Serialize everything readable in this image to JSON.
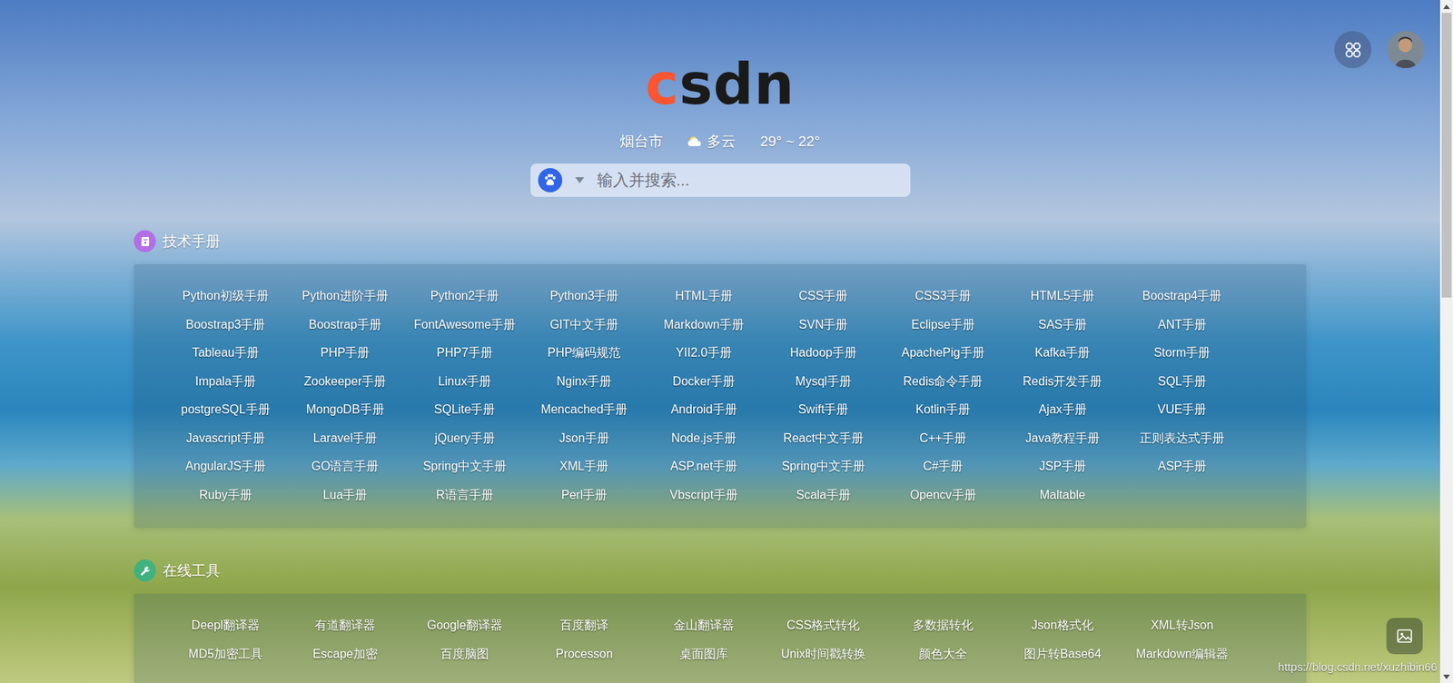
{
  "header": {
    "logo": "csdn",
    "city": "烟台市",
    "weather": "多云",
    "temperature": "29° ~ 22°"
  },
  "search": {
    "placeholder": "输入并搜索..."
  },
  "sections": [
    {
      "title": "技术手册",
      "color": "#b36ee6",
      "items": [
        "Python初级手册",
        "Python进阶手册",
        "Python2手册",
        "Python3手册",
        "HTML手册",
        "CSS手册",
        "CSS3手册",
        "HTML5手册",
        "Boostrap4手册",
        "Boostrap3手册",
        "Boostrap手册",
        "FontAwesome手册",
        "GIT中文手册",
        "Markdown手册",
        "SVN手册",
        "Eclipse手册",
        "SAS手册",
        "ANT手册",
        "Tableau手册",
        "PHP手册",
        "PHP7手册",
        "PHP编码规范",
        "YII2.0手册",
        "Hadoop手册",
        "ApachePig手册",
        "Kafka手册",
        "Storm手册",
        "Impala手册",
        "Zookeeper手册",
        "Linux手册",
        "Nginx手册",
        "Docker手册",
        "Mysql手册",
        "Redis命令手册",
        "Redis开发手册",
        "SQL手册",
        "postgreSQL手册",
        "MongoDB手册",
        "SQLite手册",
        "Mencached手册",
        "Android手册",
        "Swift手册",
        "Kotlin手册",
        "Ajax手册",
        "VUE手册",
        "Javascript手册",
        "Laravel手册",
        "jQuery手册",
        "Json手册",
        "Node.js手册",
        "React中文手册",
        "C++手册",
        "Java教程手册",
        "正则表达式手册",
        "AngularJS手册",
        "GO语言手册",
        "Spring中文手册",
        "XML手册",
        "ASP.net手册",
        "Spring中文手册",
        "C#手册",
        "JSP手册",
        "ASP手册",
        "Ruby手册",
        "Lua手册",
        "R语言手册",
        "Perl手册",
        "Vbscript手册",
        "Scala手册",
        "Opencv手册",
        "Maltable"
      ]
    },
    {
      "title": "在线工具",
      "color": "#3fb27f",
      "items": [
        "Deepl翻译器",
        "有道翻译器",
        "Google翻译器",
        "百度翻译",
        "金山翻译器",
        "CSS格式转化",
        "多数据转化",
        "Json格式化",
        "XML转Json",
        "MD5加密工具",
        "Escape加密",
        "百度脑图",
        "Processon",
        "桌面图库",
        "Unix时间戳转换",
        "颜色大全",
        "图片转Base64",
        "Markdown编辑器"
      ]
    }
  ],
  "watermark": "https://blog.csdn.net/xuzhibin66"
}
